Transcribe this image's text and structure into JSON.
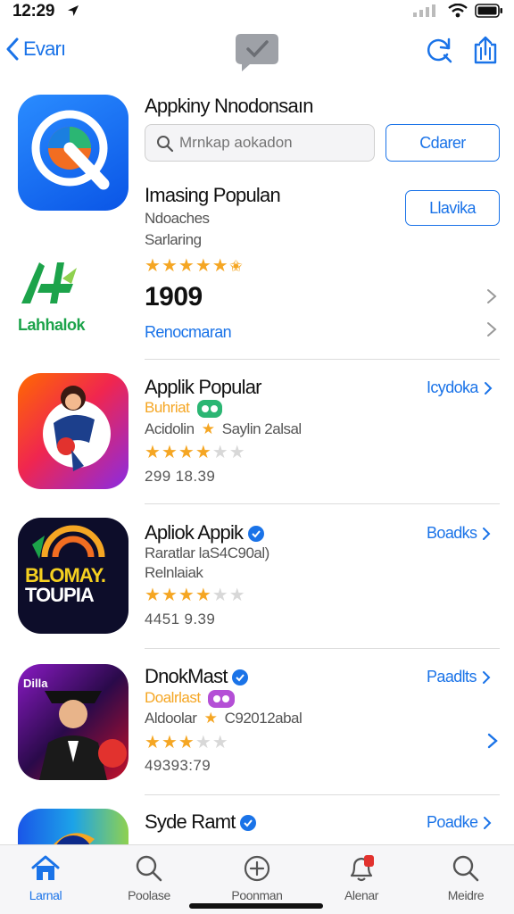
{
  "status": {
    "time": "12:29"
  },
  "nav": {
    "back_label": "Evarı"
  },
  "header": {
    "title": "Appkiny Nnodonsaın",
    "search_placeholder": "Mrnkap aokadon",
    "search_button": "Cdarer"
  },
  "featured": {
    "title": "Imasing Populan",
    "line1": "Ndoaches",
    "line2": "Sarlaring",
    "rating": 4.5,
    "count": "1909",
    "logo_text": "Lahhalok",
    "button": "Llavika",
    "link": "Renocmaran",
    "colors": {
      "accent": "#1a73e8",
      "star": "#f5a623"
    }
  },
  "apps": [
    {
      "title": "Applik Popular",
      "tag": "Buhriat",
      "meta": "Acidolin",
      "meta_rating": "Saylin 2alsal",
      "rating": 4,
      "nums": "299 18.39",
      "action": "Icydoka"
    },
    {
      "title": "Apliok Appik",
      "tag": "Raratlar laS4C90al)",
      "meta": "Relnlaiak",
      "rating": 3.5,
      "nums": "4451 9.39",
      "action": "Boadks",
      "logo_line1": "BLOMAY.",
      "logo_line2": "TOUPIA"
    },
    {
      "title": "DnokMast",
      "tag": "Doalrlast",
      "meta": "Aldoolar",
      "meta_rating": "C92012abal",
      "rating": 3,
      "nums": "49393:79",
      "action": "Paadlts",
      "logo_text": "Dilla"
    },
    {
      "title": "Syde Ramt",
      "action": "Poadke"
    }
  ],
  "tabs": [
    {
      "label": "Larnal",
      "icon": "home-icon"
    },
    {
      "label": "Poolase",
      "icon": "search-icon"
    },
    {
      "label": "Poonman",
      "icon": "add-icon"
    },
    {
      "label": "Alenar",
      "icon": "notification-icon"
    },
    {
      "label": "Meidre",
      "icon": "search-icon"
    }
  ]
}
